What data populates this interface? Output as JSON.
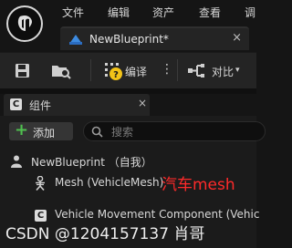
{
  "menubar": {
    "items": [
      "文件",
      "编辑",
      "资产",
      "查看",
      "调"
    ]
  },
  "editor_tab": {
    "title": "NewBlueprint*",
    "close": "×"
  },
  "toolbar": {
    "compile_label": "编译",
    "more": "⋮",
    "diff_label": "对比",
    "diff_arrow": "▾"
  },
  "components_panel": {
    "title": "组件",
    "close": "×",
    "add_label": "添加",
    "add_plus": "+",
    "search_placeholder": "搜索"
  },
  "tree": {
    "root_label": "NewBlueprint （自我）",
    "mesh_label": "Mesh (VehicleMesh)",
    "vehicle_movement_label": "Vehicle Movement Component (Vehic"
  },
  "annotation": "汽车mesh",
  "watermark": "CSDN @1204157137 肖哥",
  "colors": {
    "background": "#151515",
    "panel": "#242424",
    "accent_green": "#4fc04f",
    "annotation_red": "#ff2a2a",
    "compile_warning": "#f2c318"
  }
}
